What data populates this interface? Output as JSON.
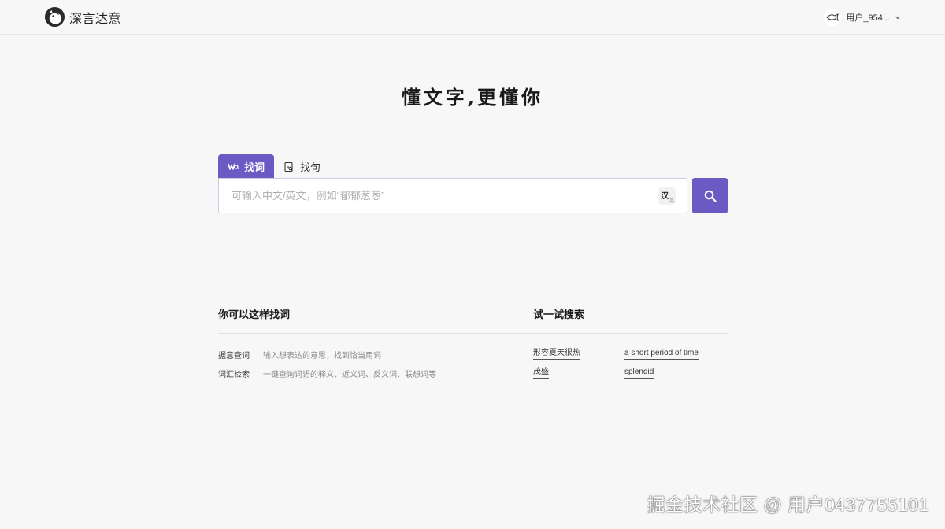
{
  "header": {
    "brand_name": "深言达意",
    "user_name": "用户_954..."
  },
  "hero": {
    "slogan": "懂文字,更懂你"
  },
  "tabs": [
    {
      "label": "找词",
      "active": true
    },
    {
      "label": "找句",
      "active": false
    }
  ],
  "search": {
    "placeholder": "可输入中文/英文，例如“郁郁葱葱”",
    "value": "",
    "lang_main": "汉",
    "lang_sub": "英"
  },
  "howto": {
    "title": "你可以这样找词",
    "items": [
      {
        "key": "据意查词",
        "desc": "输入想表达的意思，找到恰当用词"
      },
      {
        "key": "词汇检索",
        "desc": "一键查询词语的释义、近义词、反义词、联想词等"
      }
    ]
  },
  "try": {
    "title": "试一试搜索",
    "links": [
      "形容夏天很热",
      "a short period of time",
      "茂盛",
      "splendid"
    ]
  },
  "watermark": "掘金技术社区 @ 用户0437755101",
  "colors": {
    "accent": "#6b5ac3",
    "background": "#f7f7f7"
  }
}
